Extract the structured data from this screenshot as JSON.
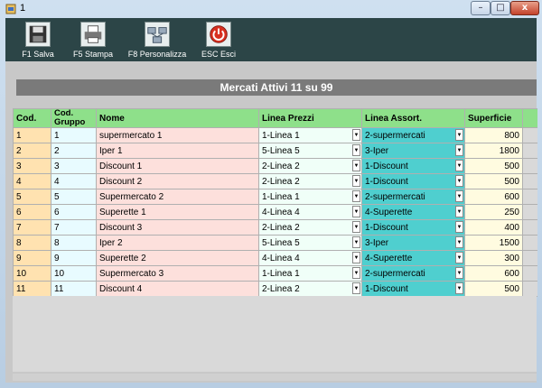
{
  "window": {
    "title": "1",
    "min": "–",
    "max": "□",
    "close": "x"
  },
  "toolbar": [
    {
      "name": "f1-salva-button",
      "label": "F1 Salva",
      "icon": "floppy-disk-icon"
    },
    {
      "name": "f5-stampa-button",
      "label": "F5 Stampa",
      "icon": "printer-icon"
    },
    {
      "name": "f8-personalizza-button",
      "label": "F8 Personalizza",
      "icon": "network-icon"
    },
    {
      "name": "esc-esci-button",
      "label": "ESC Esci",
      "icon": "power-icon"
    }
  ],
  "heading": "Mercati Attivi 11  su  99",
  "columns": {
    "cod": "Cod.",
    "grp1": "Cod.",
    "grp2": "Gruppo",
    "nome": "Nome",
    "lp": "Linea Prezzi",
    "la": "Linea Assort.",
    "sup": "Superficie"
  },
  "rows": [
    {
      "cod": "1",
      "grp": "1",
      "nome": "supermercato 1",
      "lp": "1-Linea 1",
      "la": "2-supermercati",
      "sup": "800"
    },
    {
      "cod": "2",
      "grp": "2",
      "nome": "Iper 1",
      "lp": "5-Linea 5",
      "la": "3-Iper",
      "sup": "1800"
    },
    {
      "cod": "3",
      "grp": "3",
      "nome": "Discount 1",
      "lp": "2-Linea 2",
      "la": "1-Discount",
      "sup": "500"
    },
    {
      "cod": "4",
      "grp": "4",
      "nome": "Discount 2",
      "lp": "2-Linea 2",
      "la": "1-Discount",
      "sup": "500"
    },
    {
      "cod": "5",
      "grp": "5",
      "nome": "Supermercato 2",
      "lp": "1-Linea 1",
      "la": "2-supermercati",
      "sup": "600"
    },
    {
      "cod": "6",
      "grp": "6",
      "nome": "Superette 1",
      "lp": "4-Linea 4",
      "la": "4-Superette",
      "sup": "250"
    },
    {
      "cod": "7",
      "grp": "7",
      "nome": "Discount 3",
      "lp": "2-Linea 2",
      "la": "1-Discount",
      "sup": "400"
    },
    {
      "cod": "8",
      "grp": "8",
      "nome": "Iper 2",
      "lp": "5-Linea 5",
      "la": "3-Iper",
      "sup": "1500"
    },
    {
      "cod": "9",
      "grp": "9",
      "nome": "Superette 2",
      "lp": "4-Linea 4",
      "la": "4-Superette",
      "sup": "300"
    },
    {
      "cod": "10",
      "grp": "10",
      "nome": "Supermercato 3",
      "lp": "1-Linea 1",
      "la": "2-supermercati",
      "sup": "600"
    },
    {
      "cod": "11",
      "grp": "11",
      "nome": "Discount 4",
      "lp": "2-Linea 2",
      "la": "1-Discount",
      "sup": "500"
    }
  ],
  "dropdown_arrow": "▼"
}
